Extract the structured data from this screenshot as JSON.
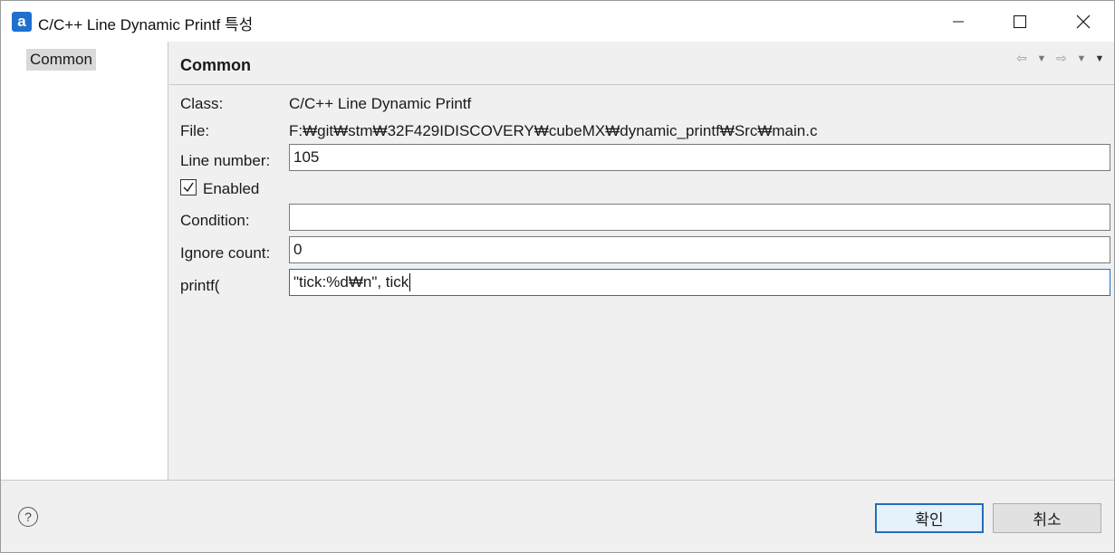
{
  "window": {
    "app_icon_letter": "a",
    "title": "C/C++ Line Dynamic Printf 특성"
  },
  "sidebar": {
    "items": [
      {
        "label": "Common"
      }
    ]
  },
  "panel": {
    "title": "Common",
    "class_label": "Class:",
    "class_value": "C/C++ Line Dynamic Printf",
    "file_label": "File:",
    "file_value": "F:₩git₩stm₩32F429IDISCOVERY₩cubeMX₩dynamic_printf₩Src₩main.c",
    "line_number_label": "Line number:",
    "line_number_value": "105",
    "enabled_label": "Enabled",
    "enabled_checked": true,
    "condition_label": "Condition:",
    "condition_value": "",
    "ignore_count_label": "Ignore count:",
    "ignore_count_value": "0",
    "printf_label": "printf(",
    "printf_value": "\"tick:%d₩n\", tick"
  },
  "footer": {
    "ok_label": "확인",
    "cancel_label": "취소"
  },
  "colors": {
    "accent": "#1f6fbf",
    "app_icon": "#1e6fd0"
  }
}
